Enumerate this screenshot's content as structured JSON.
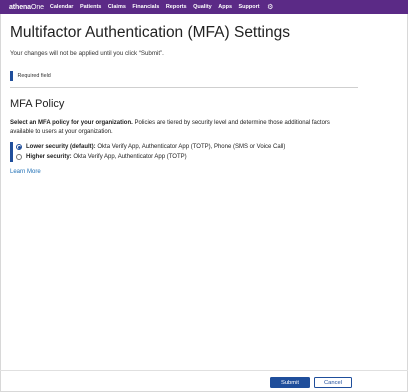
{
  "nav": {
    "logo": "athena",
    "logo_suffix": "One",
    "items": [
      "Calendar",
      "Patients",
      "Claims",
      "Financials",
      "Reports",
      "Quality",
      "Apps",
      "Support"
    ],
    "settings_icon": "gear-icon",
    "bg_color": "#5b2a86"
  },
  "page": {
    "title": "Multifactor Authentication (MFA) Settings",
    "subtitle": "Your changes will not be applied until you click “Submit”.",
    "required_label": "Required field"
  },
  "policy": {
    "heading": "MFA Policy",
    "desc_bold": "Select an MFA policy for your organization.",
    "desc_rest": " Policies are tiered by security level and determine those additional factors available to users at your organization.",
    "options": [
      {
        "label_bold": "Lower security (default):",
        "label_rest": " Okta Verify App, Authenticator App (TOTP), Phone (SMS or Voice Call)",
        "selected": true
      },
      {
        "label_bold": "Higher security:",
        "label_rest": " Okta Verify App, Authenticator App (TOTP)",
        "selected": false
      }
    ],
    "learn_more": "Learn More"
  },
  "footer": {
    "submit": "Submit",
    "cancel": "Cancel",
    "accent": "#1f4e9b"
  }
}
